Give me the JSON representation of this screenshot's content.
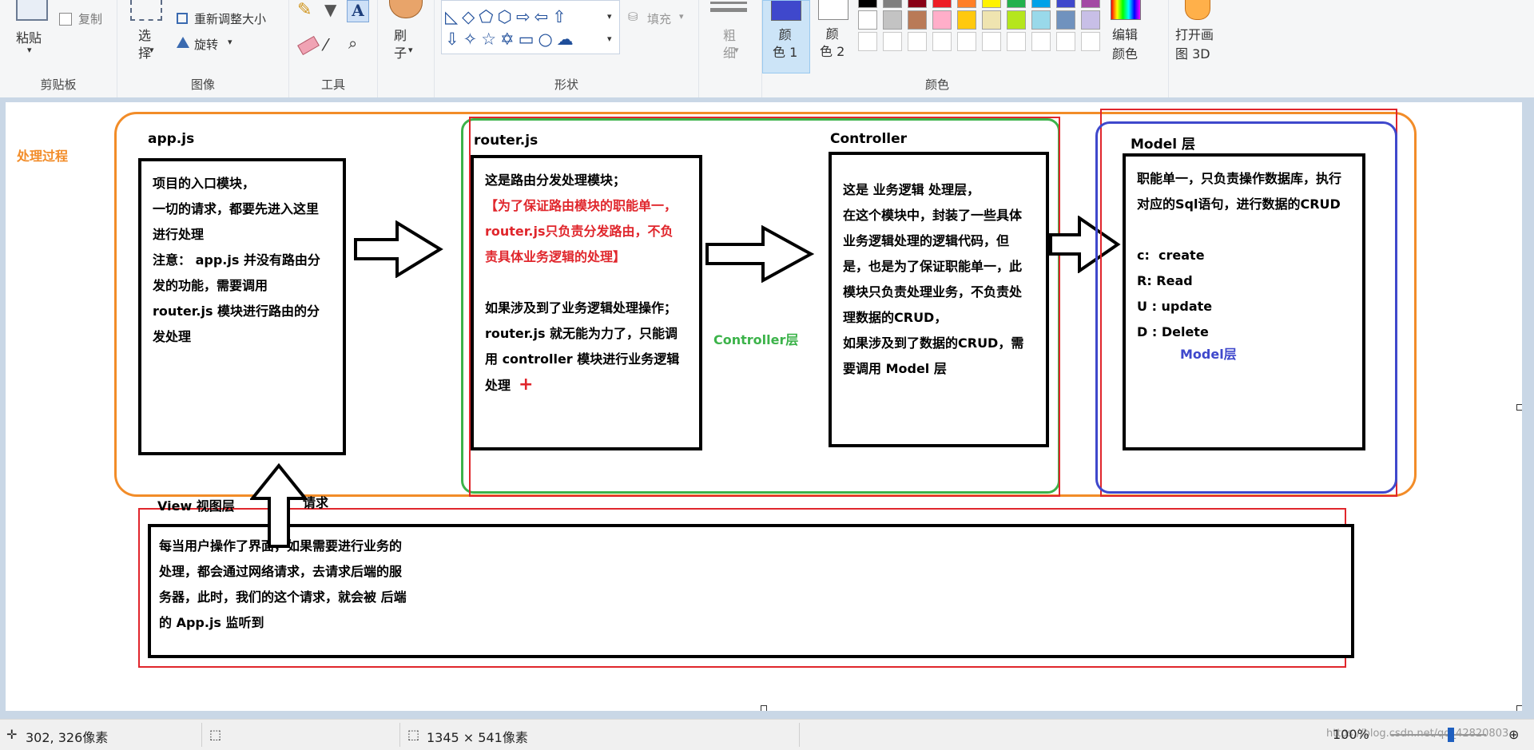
{
  "ribbon": {
    "clipboard": {
      "paste": "粘贴",
      "copy": "复制",
      "group": "剪贴板"
    },
    "image": {
      "select": "选\n择",
      "resize": "重新调整大小",
      "rotate": "旋转",
      "group": "图像"
    },
    "tools": {
      "group": "工具"
    },
    "brushes": {
      "label": "刷\n子"
    },
    "shapes": {
      "fill": "填充",
      "group": "形状"
    },
    "size": {
      "label": "粗\n细"
    },
    "colors": {
      "color1": "颜\n色 1",
      "color2": "颜\n色 2",
      "edit": "编辑\n颜色",
      "group": "颜色",
      "palette_row1": [
        "#000000",
        "#7f7f7f",
        "#880015",
        "#ed1c24",
        "#ff7f27",
        "#fff200",
        "#22b14c",
        "#00a2e8",
        "#3f48cc",
        "#a349a4"
      ],
      "palette_row2": [
        "#ffffff",
        "#c3c3c3",
        "#b97a57",
        "#ffaec9",
        "#ffc90e",
        "#efe4b0",
        "#b5e61d",
        "#99d9ea",
        "#7092be",
        "#c8bfe7"
      ],
      "active_color1": "#3f48cc",
      "active_color2": "#ffffff"
    },
    "paint3d": "打开画\n图 3D"
  },
  "diagram": {
    "process_label": "处理过程",
    "app": {
      "title": "app.js",
      "text": "项目的入口模块，\n一切的请求，都要先进入这里\n进行处理\n注意： app.js 并没有路由分\n发的功能，需要调用\nrouter.js 模块进行路由的分\n发处理"
    },
    "router": {
      "title": "router.js",
      "text1": "这是路由分发处理模块；",
      "text_red": "【为了保证路由模块的职能单一，\nrouter.js只负责分发路由，不负\n责具体业务逻辑的处理】",
      "text2": "如果涉及到了业务逻辑处理操作；\nrouter.js 就无能为力了，只能调\n用 controller 模块进行业务逻辑\n处理",
      "plus": "+"
    },
    "controller_layer_label": "Controller层",
    "controller": {
      "title": "Controller",
      "text": "这是 业务逻辑 处理层，\n在这个模块中，封装了一些具体\n业务逻辑处理的逻辑代码，但\n是，也是为了保证职能单一，此\n模块只负责处理业务，不负责处\n理数据的CRUD，\n如果涉及到了数据的CRUD，需\n要调用 Model 层"
    },
    "model": {
      "title": "Model 层",
      "text": "职能单一，只负责操作数据库，执行\n对应的Sql语句，进行数据的CRUD\n\nc:  create\nR: Read\nU : update\nD : Delete"
    },
    "model_layer_label": "Model层",
    "view": {
      "title": "View 视图层",
      "request": "请求",
      "text": "每当用户操作了界面，如果需要进行业务的\n处理，都会通过网络请求，去请求后端的服\n务器，此时，我们的这个请求，就会被 后端\n的 App.js 监听到"
    }
  },
  "status": {
    "cursor_pos": "302, 326像素",
    "image_size": "1345 × 541像素",
    "zoom": "100%",
    "watermark": "https://blog.csdn.net/qq_42820803"
  }
}
